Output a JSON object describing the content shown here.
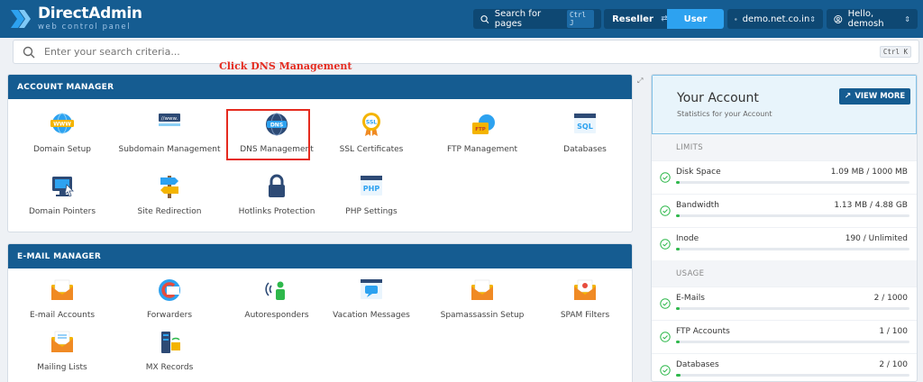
{
  "header": {
    "logo_title": "DirectAdmin",
    "logo_subtitle": "web control panel",
    "search_pages_label": "Search for pages",
    "search_pages_shortcut": "Ctrl J",
    "role_reseller": "Reseller",
    "role_user": "User",
    "domain": "demo.net.co.in",
    "greeting": "Hello, demosh"
  },
  "search": {
    "placeholder": "Enter your search criteria...",
    "shortcut": "Ctrl K"
  },
  "annotation": "Click DNS Management",
  "account_manager": {
    "title": "ACCOUNT MANAGER",
    "tiles": [
      {
        "label": "Domain Setup",
        "icon": "www-globe-icon"
      },
      {
        "label": "Subdomain Management",
        "icon": "www-bar-icon"
      },
      {
        "label": "DNS Management",
        "icon": "dns-icon"
      },
      {
        "label": "SSL Certificates",
        "icon": "ssl-badge-icon"
      },
      {
        "label": "FTP Management",
        "icon": "ftp-folder-icon"
      },
      {
        "label": "Databases",
        "icon": "sql-window-icon"
      },
      {
        "label": "Domain Pointers",
        "icon": "monitor-pointer-icon"
      },
      {
        "label": "Site Redirection",
        "icon": "signpost-icon"
      },
      {
        "label": "Hotlinks Protection",
        "icon": "padlock-icon"
      },
      {
        "label": "PHP Settings",
        "icon": "php-window-icon"
      }
    ]
  },
  "email_manager": {
    "title": "E-MAIL MANAGER",
    "tiles": [
      {
        "label": "E-mail Accounts",
        "icon": "envelope-icon"
      },
      {
        "label": "Forwarders",
        "icon": "forward-icon"
      },
      {
        "label": "Autoresponders",
        "icon": "autoresponder-icon"
      },
      {
        "label": "Vacation Messages",
        "icon": "vacation-chat-icon"
      },
      {
        "label": "Spamassassin Setup",
        "icon": "spam-envelope-icon"
      },
      {
        "label": "SPAM Filters",
        "icon": "spam-filter-icon"
      },
      {
        "label": "Mailing Lists",
        "icon": "mailing-list-icon"
      },
      {
        "label": "MX Records",
        "icon": "mx-records-icon"
      }
    ]
  },
  "account_panel": {
    "title": "Your Account",
    "subtitle": "Statistics for your Account",
    "view_more": "VIEW MORE",
    "limits_label": "LIMITS",
    "usage_label": "USAGE",
    "limits": [
      {
        "label": "Disk Space",
        "value": "1.09 MB / 1000 MB",
        "fraction": 0.011
      },
      {
        "label": "Bandwidth",
        "value": "1.13 MB / 4.88 GB",
        "fraction": 0.01
      },
      {
        "label": "Inode",
        "value": "190 / Unlimited",
        "fraction": 0.01
      }
    ],
    "usage": [
      {
        "label": "E-Mails",
        "value": "2 / 1000",
        "fraction": 0.01
      },
      {
        "label": "FTP Accounts",
        "value": "1 / 100",
        "fraction": 0.01
      },
      {
        "label": "Databases",
        "value": "2 / 100",
        "fraction": 0.02
      }
    ]
  },
  "colors": {
    "brand": "#155c91",
    "accent": "#2da2f0",
    "annotation": "#e52b1f",
    "ok": "#2eb84b"
  }
}
